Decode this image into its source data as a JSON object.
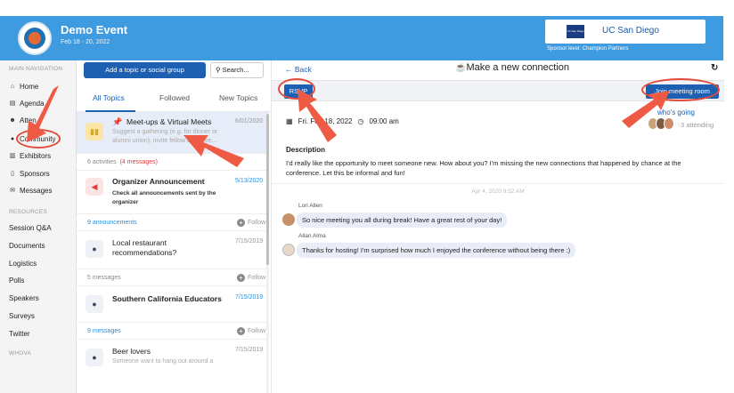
{
  "header": {
    "event_title": "Demo Event",
    "event_date": "Feb 18 - 20, 2022",
    "sponsor_name": "UC San Diego",
    "sponsor_logo_text": "UC San Diego",
    "sponsor_level": "Sponsor level: Champion Partners"
  },
  "nav": {
    "main_label": "MAIN NAVIGATION",
    "items": [
      {
        "label": "Home",
        "icon": "home-icon"
      },
      {
        "label": "Agenda",
        "icon": "calendar-icon"
      },
      {
        "label": "Atten",
        "icon": "people-icon"
      },
      {
        "label": "Community",
        "icon": "chat-icon"
      },
      {
        "label": "Exhibitors",
        "icon": "building-icon"
      },
      {
        "label": "Sponsors",
        "icon": "badge-icon"
      },
      {
        "label": "Messages",
        "icon": "envelope-icon"
      }
    ],
    "resources_label": "RESOURCES",
    "resources": [
      "Session Q&A",
      "Documents",
      "Logistics",
      "Polls",
      "Speakers",
      "Surveys",
      "Twitter"
    ],
    "whova_label": "WHOVA"
  },
  "middle": {
    "add_button": "Add a topic or social group",
    "search_placeholder": "Search...",
    "tabs": [
      "All Topics",
      "Followed",
      "New Topics"
    ],
    "topics": [
      {
        "title": "Meet-ups & Virtual Meets",
        "date": "6/01/2020",
        "subtitle": "Suggest a gathering (e.g. for dinner or alumni union), invite fellow attendee..."
      },
      {
        "title": "Organizer Announcement",
        "date": "5/13/2020",
        "subtitle": "Check all announcements sent by the organizer"
      },
      {
        "title": "Local restaurant recommendations?",
        "date": "7/15/2019"
      },
      {
        "title": "Southern California Educators",
        "date": "7/15/2019"
      },
      {
        "title": "Beer lovers",
        "date": "7/15/2019",
        "subtitle": "Someone want to hang out around a"
      }
    ],
    "meta": [
      {
        "left": "6 activities",
        "extra": "(4 messages)"
      },
      {
        "left": "9 announcements",
        "follow": "Follow"
      },
      {
        "left": "5 messages",
        "follow": "Follow"
      },
      {
        "left": "9 messages",
        "follow": "Follow"
      }
    ]
  },
  "right": {
    "back_label": "← Back",
    "title": "Make a new connection",
    "rsvp_label": "RSVP",
    "join_label": "Join meeting room",
    "date_text": "Fri. Feb 18, 2022",
    "time_text": "09:00 am",
    "whos_going": "who's going",
    "attending": "3 attending",
    "description_label": "Description",
    "description_text": "I'd really like the opportunity to meet someone new. How about you? I'm missing the new connections that happened by chance at the conference. Let this be informal and fun!",
    "timestamp": "Apr 4, 2020 9:52 AM",
    "messages": [
      {
        "name": "Lori Allen",
        "text": "So nice meeting you all during break! Have a great rest of your day!"
      },
      {
        "name": "Allan Alma",
        "text": "Thanks for hosting! I'm surprised how much I enjoyed the conference without being there :)"
      }
    ]
  },
  "colors": {
    "header_blue": "#3f9be0",
    "primary_blue": "#1d5fb1",
    "annotation_red": "#e34b3b"
  }
}
